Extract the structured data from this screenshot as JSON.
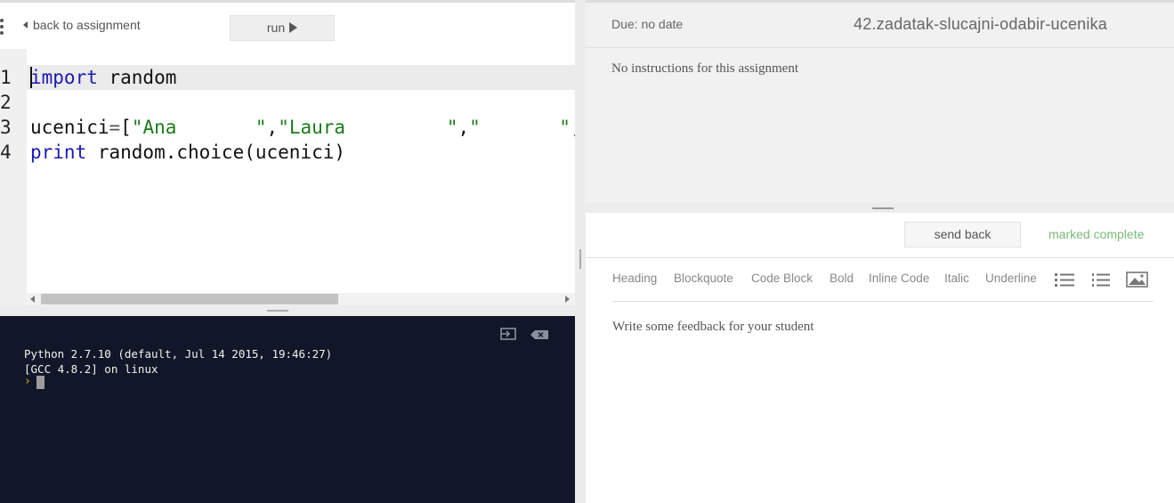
{
  "editor": {
    "back_label": "back to assignment",
    "run_label": "run",
    "line_numbers": [
      "1",
      "2",
      "3",
      "4"
    ],
    "lines": {
      "l1_kw": "import",
      "l1_rest": " random",
      "l3_name": "ucenici",
      "l3_op": "=",
      "l3_open": "[",
      "l3_s1": "\"Ana       \"",
      "l3_c1": ",",
      "l3_s2": "\"Laura         \"",
      "l3_c2": ",",
      "l3_s3": "\"       \"",
      "l3_c3": ",\"",
      "l4_kw": "print",
      "l4_rest": " random.choice(ucenici)"
    }
  },
  "terminal": {
    "line1": "Python 2.7.10 (default, Jul 14 2015, 19:46:27)",
    "line2": "[GCC 4.8.2] on linux",
    "prompt": "›"
  },
  "assignment": {
    "due": "Due: no date",
    "title": "42.zadatak-slucajni-odabir-ucenika",
    "instructions": "No instructions for this assignment"
  },
  "review": {
    "send_back_label": "send back",
    "status": "marked complete",
    "status_color": "#7ab97a",
    "toolbar": [
      "Heading",
      "Blockquote",
      "Code Block",
      "Bold",
      "Inline Code",
      "Italic",
      "Underline"
    ],
    "toolbar_icons": [
      "bulleted-list-icon",
      "numbered-list-icon",
      "image-icon"
    ],
    "feedback_placeholder": "Write some feedback for your student"
  }
}
